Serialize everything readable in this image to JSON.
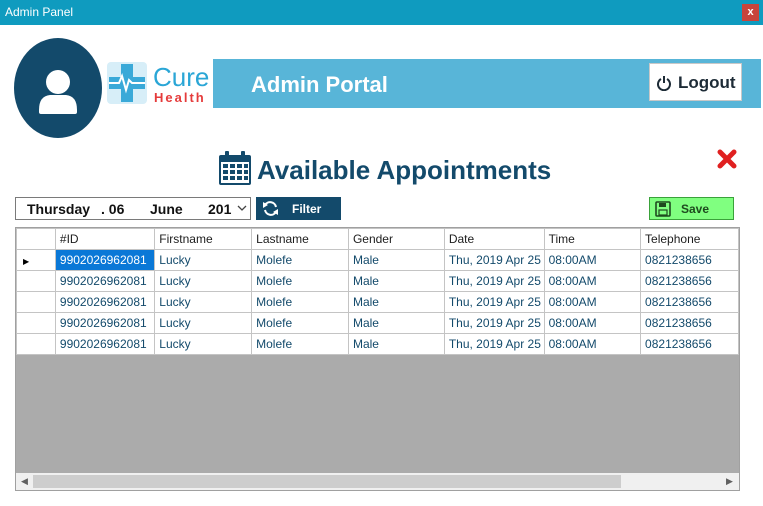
{
  "window": {
    "title": "Admin Panel",
    "close_glyph": "x"
  },
  "brand": {
    "name_part1": "Cure",
    "name_part2": "Health"
  },
  "header": {
    "title": "Admin Portal",
    "logout_label": "Logout"
  },
  "page": {
    "title": "Available Appointments"
  },
  "date_picker": {
    "weekday": "Thursday",
    "day": ". 06",
    "month": "June",
    "year": "201"
  },
  "toolbar": {
    "filter_label": "Filter",
    "save_label": "Save"
  },
  "table": {
    "columns": [
      "#ID",
      "Firstname",
      "Lastname",
      "Gender",
      "Date",
      "Time",
      "Telephone"
    ],
    "rows": [
      [
        "9902026962081",
        "Lucky",
        "Molefe",
        "Male",
        "Thu, 2019 Apr 25",
        "08:00AM",
        "0821238656"
      ],
      [
        "9902026962081",
        "Lucky",
        "Molefe",
        "Male",
        "Thu, 2019 Apr 25",
        "08:00AM",
        "0821238656"
      ],
      [
        "9902026962081",
        "Lucky",
        "Molefe",
        "Male",
        "Thu, 2019 Apr 25",
        "08:00AM",
        "0821238656"
      ],
      [
        "9902026962081",
        "Lucky",
        "Molefe",
        "Male",
        "Thu, 2019 Apr 25",
        "08:00AM",
        "0821238656"
      ],
      [
        "9902026962081",
        "Lucky",
        "Molefe",
        "Male",
        "Thu, 2019 Apr 25",
        "08:00AM",
        "0821238656"
      ]
    ],
    "current_row_marker": "▶"
  },
  "colors": {
    "titlebar": "#0f9bbf",
    "accent_dark": "#134a6b",
    "banner": "#58b5d8",
    "save_green": "#80ff80",
    "selection": "#0a78d7"
  },
  "icons": [
    "user-icon",
    "cross-logo-icon",
    "power-icon",
    "calendar-icon",
    "close-x-icon",
    "refresh-icon",
    "floppy-disk-icon",
    "chevron-down-icon"
  ]
}
